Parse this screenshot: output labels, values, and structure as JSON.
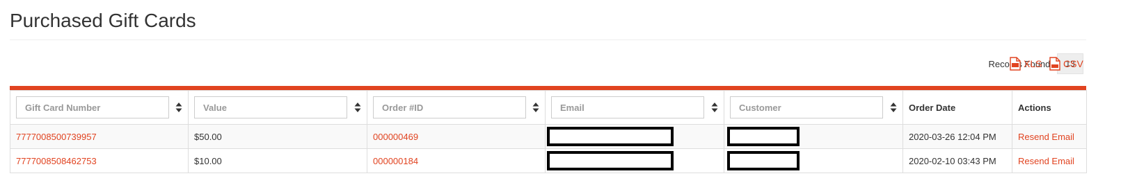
{
  "page": {
    "title": "Purchased Gift Cards"
  },
  "records": {
    "label": "Records Found:",
    "count": "13"
  },
  "exports": {
    "xls_label": "XLS",
    "csv_label": "CSV"
  },
  "colors": {
    "accent": "#e14320",
    "link": "#e14320"
  },
  "table": {
    "filters": {
      "gift_card_number": "Gift Card Number",
      "value": "Value",
      "order_id": "Order #ID",
      "email": "Email",
      "customer": "Customer"
    },
    "headers": {
      "order_date": "Order Date",
      "actions": "Actions"
    },
    "rows": [
      {
        "gift_card_number": "7777008500739957",
        "value": "$50.00",
        "order_id": "000000469",
        "order_date": "2020-03-26 12:04 PM",
        "action": "Resend Email"
      },
      {
        "gift_card_number": "7777008508462753",
        "value": "$10.00",
        "order_id": "000000184",
        "order_date": "2020-02-10 03:43 PM",
        "action": "Resend Email"
      }
    ]
  },
  "icons": {
    "sort": "sort-both-icon",
    "xls": "xls-file-icon",
    "csv": "csv-file-icon"
  }
}
